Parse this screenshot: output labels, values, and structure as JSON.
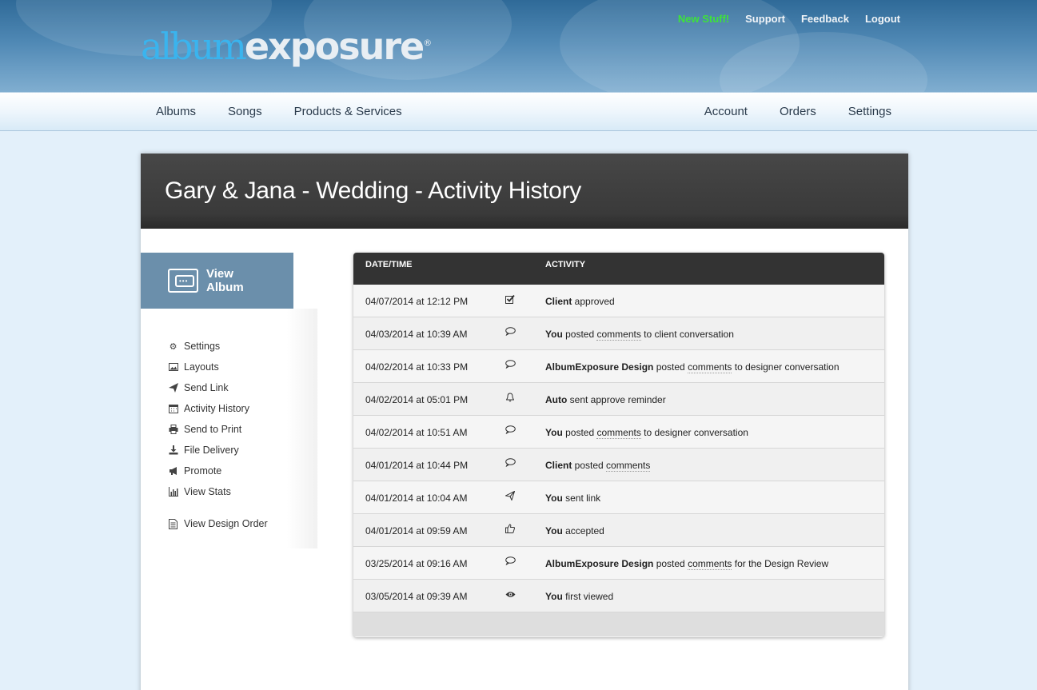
{
  "header": {
    "logo_part1": "album",
    "logo_part2": "exposure",
    "logo_reg": "®",
    "top_links": [
      "New Stuff!",
      "Support",
      "Feedback",
      "Logout"
    ]
  },
  "nav": {
    "left": [
      "Albums",
      "Songs",
      "Products & Services"
    ],
    "right": [
      "Account",
      "Orders",
      "Settings"
    ]
  },
  "page": {
    "title": "Gary & Jana - Wedding - Activity History"
  },
  "sidebar": {
    "view_album": "View Album",
    "items": [
      {
        "label": "Settings",
        "icon": "gear-icon"
      },
      {
        "label": "Layouts",
        "icon": "image-icon"
      },
      {
        "label": "Send Link",
        "icon": "paper-plane-icon"
      },
      {
        "label": "Activity History",
        "icon": "calendar-icon"
      },
      {
        "label": "Send to Print",
        "icon": "printer-icon"
      },
      {
        "label": "File Delivery",
        "icon": "download-icon"
      },
      {
        "label": "Promote",
        "icon": "megaphone-icon"
      },
      {
        "label": "View Stats",
        "icon": "bar-chart-icon"
      },
      {
        "label": "View Design Order",
        "icon": "document-icon"
      }
    ]
  },
  "table": {
    "headers": [
      "DATE/TIME",
      "ACTIVITY"
    ],
    "rows": [
      {
        "datetime": "04/07/2014 at 12:12 PM",
        "icon": "check-icon",
        "actor": "Client",
        "pre": " approved",
        "link": "",
        "post": ""
      },
      {
        "datetime": "04/03/2014 at 10:39 AM",
        "icon": "comment-icon",
        "actor": "You",
        "pre": " posted ",
        "link": "comments",
        "post": " to client conversation"
      },
      {
        "datetime": "04/02/2014 at 10:33 PM",
        "icon": "comment-icon",
        "actor": "AlbumExposure Design",
        "pre": " posted ",
        "link": "comments",
        "post": " to designer conversation"
      },
      {
        "datetime": "04/02/2014 at 05:01 PM",
        "icon": "bell-icon",
        "actor": "Auto",
        "pre": " sent approve reminder",
        "link": "",
        "post": ""
      },
      {
        "datetime": "04/02/2014 at 10:51 AM",
        "icon": "comment-icon",
        "actor": "You",
        "pre": " posted ",
        "link": "comments",
        "post": " to designer conversation"
      },
      {
        "datetime": "04/01/2014 at 10:44 PM",
        "icon": "comment-icon",
        "actor": "Client",
        "pre": " posted ",
        "link": "comments",
        "post": ""
      },
      {
        "datetime": "04/01/2014 at 10:04 AM",
        "icon": "paper-plane-icon",
        "actor": "You",
        "pre": " sent link",
        "link": "",
        "post": ""
      },
      {
        "datetime": "04/01/2014 at 09:59 AM",
        "icon": "thumbs-up-icon",
        "actor": "You",
        "pre": " accepted",
        "link": "",
        "post": ""
      },
      {
        "datetime": "03/25/2014 at 09:16 AM",
        "icon": "comment-icon",
        "actor": "AlbumExposure Design",
        "pre": " posted ",
        "link": "comments",
        "post": " for the Design Review"
      },
      {
        "datetime": "03/05/2014 at 09:39 AM",
        "icon": "eye-icon",
        "actor": "You",
        "pre": " first viewed",
        "link": "",
        "post": ""
      }
    ]
  },
  "colors": {
    "header_blue": "#4f88b4",
    "new_stuff_green": "#3ee23a",
    "view_album_bg": "#6b8fab",
    "title_bar": "#3f3f3f"
  }
}
